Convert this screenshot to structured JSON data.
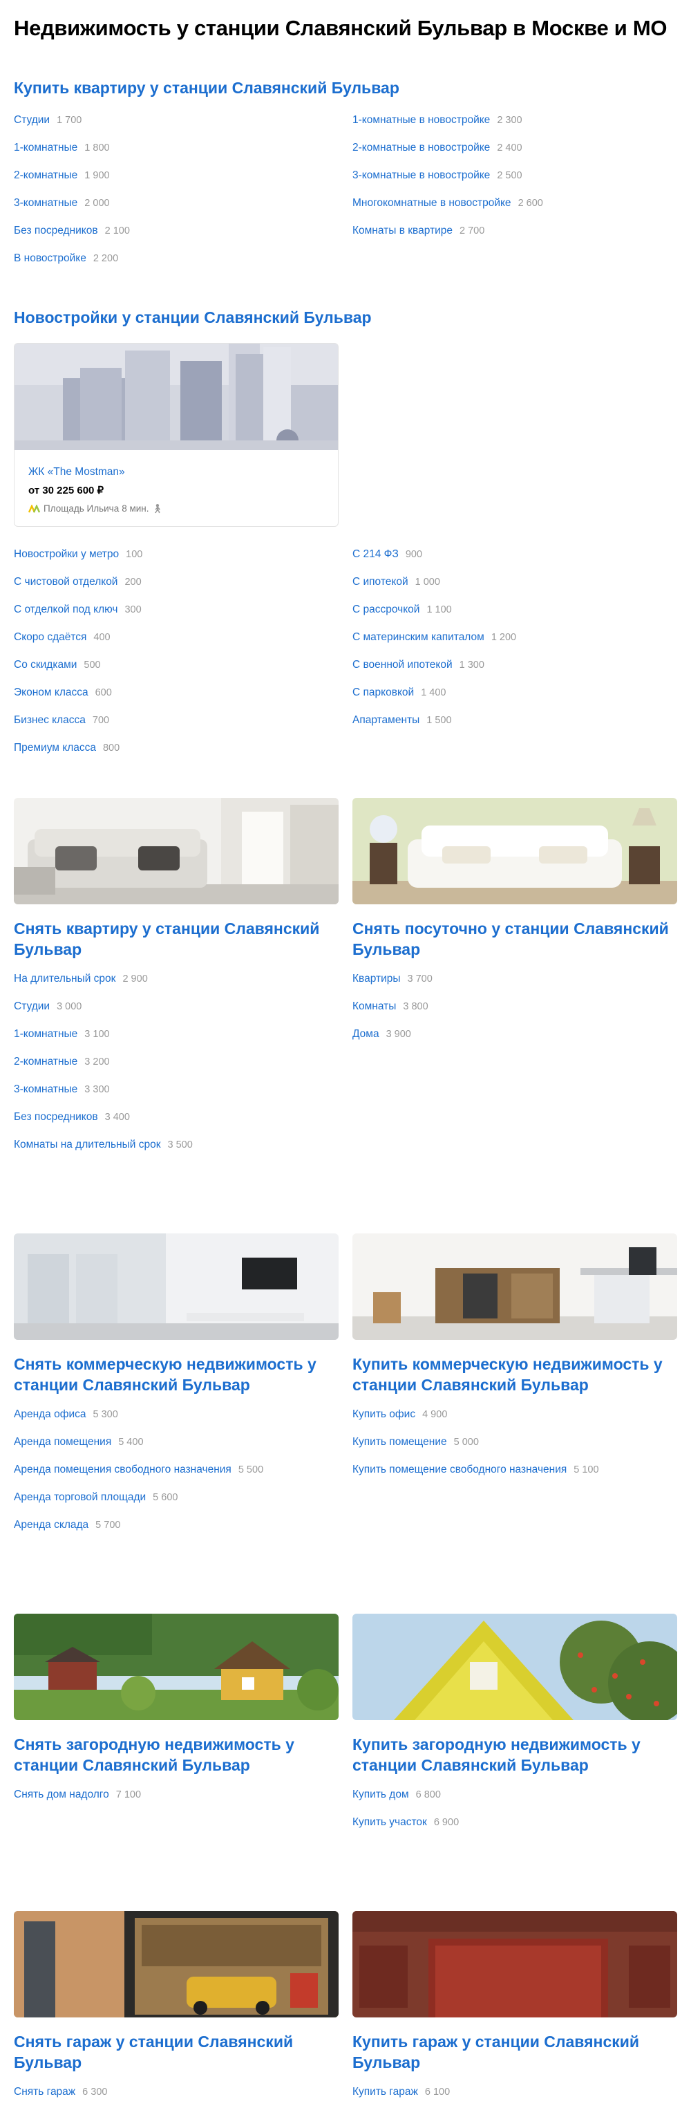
{
  "page": {
    "title": "Недвижимость у станции Славянский Бульвар в Москве и МО"
  },
  "buy_flats": {
    "heading": "Купить квартиру у станции Славянский Бульвар",
    "left": [
      {
        "label": "Студии",
        "count": "1 700"
      },
      {
        "label": "1-комнатные",
        "count": "1 800"
      },
      {
        "label": "2-комнатные",
        "count": "1 900"
      },
      {
        "label": "3-комнатные",
        "count": "2 000"
      },
      {
        "label": "Без посредников",
        "count": "2 100"
      },
      {
        "label": "В новостройке",
        "count": "2 200"
      }
    ],
    "right": [
      {
        "label": "1-комнатные в новостройке",
        "count": "2 300"
      },
      {
        "label": "2-комнатные в новостройке",
        "count": "2 400"
      },
      {
        "label": "3-комнатные в новостройке",
        "count": "2 500"
      },
      {
        "label": "Многокомнатные в новостройке",
        "count": "2 600"
      },
      {
        "label": "Комнаты в квартире",
        "count": "2 700"
      }
    ]
  },
  "newbuilds": {
    "heading": "Новостройки у станции Славянский Бульвар",
    "card": {
      "name": "ЖК «The Mostman»",
      "price": "от 30 225 600 ₽",
      "metro": "Площадь Ильича",
      "walk": "8 мин.",
      "walk_icon": "pedestrian-icon",
      "metro_color_1": "#f2c000",
      "metro_color_2": "#9bc53d"
    },
    "left": [
      {
        "label": "Новостройки у метро",
        "count": "100"
      },
      {
        "label": "С чистовой отделкой",
        "count": "200"
      },
      {
        "label": "С отделкой под ключ",
        "count": "300"
      },
      {
        "label": "Скоро сдаётся",
        "count": "400"
      },
      {
        "label": "Со скидками",
        "count": "500"
      },
      {
        "label": "Эконом класса",
        "count": "600"
      },
      {
        "label": "Бизнес класса",
        "count": "700"
      },
      {
        "label": "Премиум класса",
        "count": "800"
      }
    ],
    "right": [
      {
        "label": "С 214 ФЗ",
        "count": "900"
      },
      {
        "label": "С ипотекой",
        "count": "1 000"
      },
      {
        "label": "С рассрочкой",
        "count": "1 100"
      },
      {
        "label": "С материнским капиталом",
        "count": "1 200"
      },
      {
        "label": "С военной ипотекой",
        "count": "1 300"
      },
      {
        "label": "С парковкой",
        "count": "1 400"
      },
      {
        "label": "Апартаменты",
        "count": "1 500"
      }
    ]
  },
  "rent_flat": {
    "heading": "Снять квартиру у станции Славянский Бульвар",
    "items": [
      {
        "label": "На длительный срок",
        "count": "2 900"
      },
      {
        "label": "Студии",
        "count": "3 000"
      },
      {
        "label": "1-комнатные",
        "count": "3 100"
      },
      {
        "label": "2-комнатные",
        "count": "3 200"
      },
      {
        "label": "3-комнатные",
        "count": "3 300"
      },
      {
        "label": "Без посредников",
        "count": "3 400"
      },
      {
        "label": "Комнаты на длительный срок",
        "count": "3 500"
      }
    ]
  },
  "rent_daily": {
    "heading": "Снять посуточно у станции Славянский Бульвар",
    "items": [
      {
        "label": "Квартиры",
        "count": "3 700"
      },
      {
        "label": "Комнаты",
        "count": "3 800"
      },
      {
        "label": "Дома",
        "count": "3 900"
      }
    ]
  },
  "rent_commercial": {
    "heading": "Снять коммерческую недвижимость у станции Славянский Бульвар",
    "items": [
      {
        "label": "Аренда офиса",
        "count": "5 300"
      },
      {
        "label": "Аренда помещения",
        "count": "5 400"
      },
      {
        "label": "Аренда помещения свободного назначения",
        "count": "5 500"
      },
      {
        "label": "Аренда торговой площади",
        "count": "5 600"
      },
      {
        "label": "Аренда склада",
        "count": "5 700"
      }
    ]
  },
  "buy_commercial": {
    "heading": "Купить коммерческую недвижимость у станции Славянский Бульвар",
    "items": [
      {
        "label": "Купить офис",
        "count": "4 900"
      },
      {
        "label": "Купить помещение",
        "count": "5 000"
      },
      {
        "label": "Купить помещение свободного назначения",
        "count": "5 100"
      }
    ]
  },
  "rent_country": {
    "heading": "Снять загородную недвижимость у станции Славянский Бульвар",
    "items": [
      {
        "label": "Снять дом надолго",
        "count": "7 100"
      }
    ]
  },
  "buy_country": {
    "heading": "Купить загородную недвижимость у станции Славянский Бульвар",
    "items": [
      {
        "label": "Купить дом",
        "count": "6 800"
      },
      {
        "label": "Купить участок",
        "count": "6 900"
      }
    ]
  },
  "rent_garage": {
    "heading": "Снять гараж у станции Славянский Бульвар",
    "items": [
      {
        "label": "Снять гараж",
        "count": "6 300"
      }
    ]
  },
  "buy_garage": {
    "heading": "Купить гараж у станции Славянский Бульвар",
    "items": [
      {
        "label": "Купить гараж",
        "count": "6 100"
      }
    ]
  },
  "colors": {
    "link": "#1c6ecf",
    "count": "#999999",
    "text": "#000000"
  }
}
